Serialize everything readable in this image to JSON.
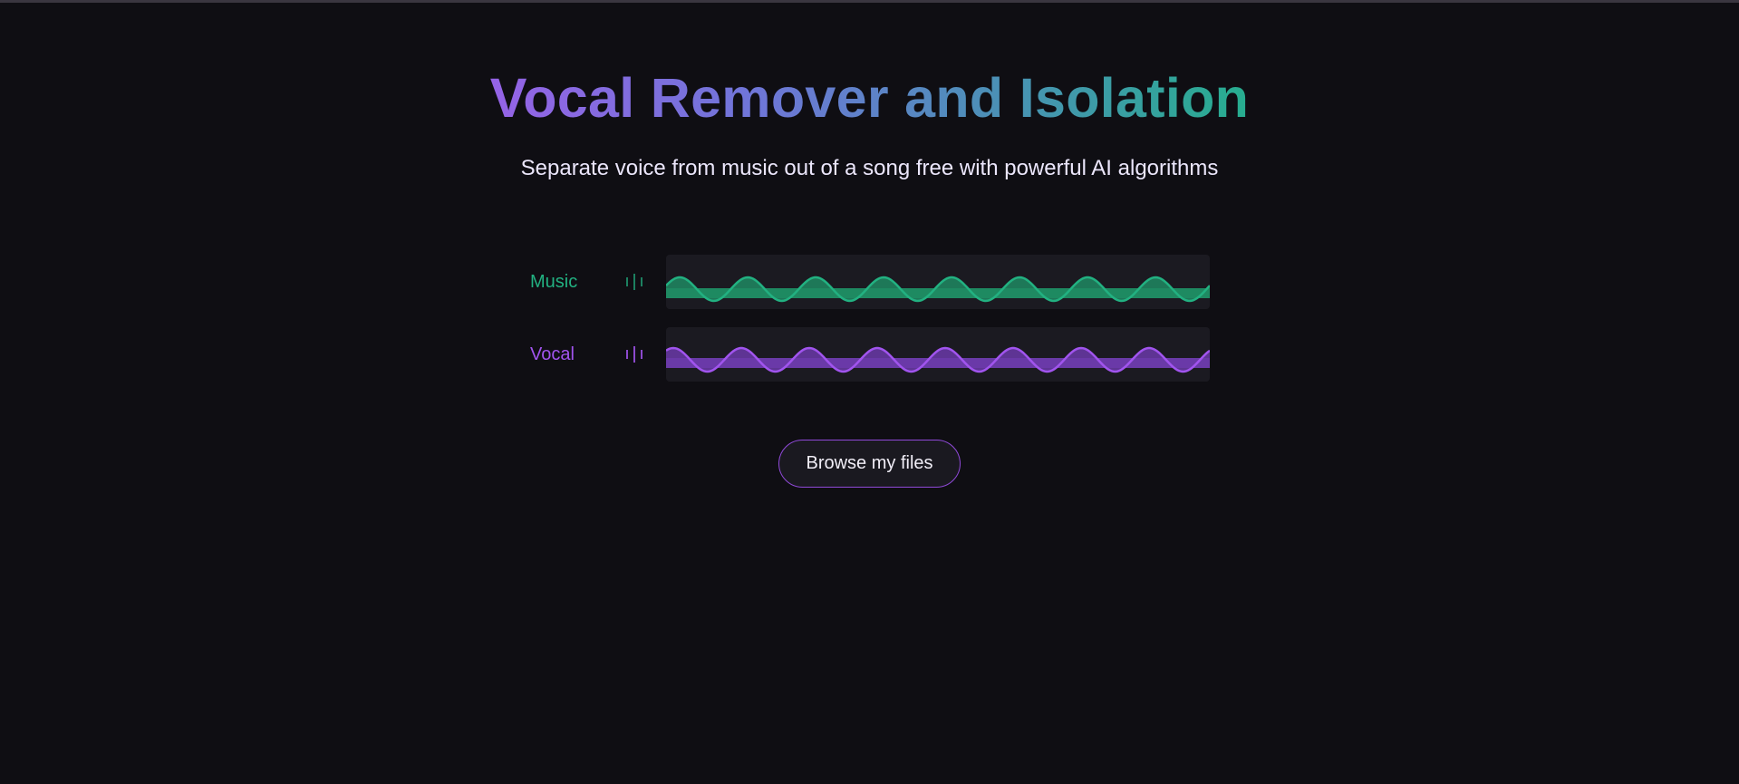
{
  "header": {
    "title": "Vocal Remover and Isolation",
    "subtitle": "Separate voice from music out of a song free with powerful AI algorithms"
  },
  "tracks": [
    {
      "label": "Music",
      "icon": "equalizer-icon",
      "color": "#22b181",
      "fill": "#1f8a62"
    },
    {
      "label": "Vocal",
      "icon": "equalizer-icon",
      "color": "#a154ee",
      "fill": "#6a3aa8"
    }
  ],
  "actions": {
    "browse_label": "Browse my files"
  },
  "colors": {
    "background": "#0f0e13",
    "panel": "#1b1a21",
    "button_border": "#8f49d8",
    "gradient_start": "#9563e6",
    "gradient_end": "#27ad8f"
  }
}
